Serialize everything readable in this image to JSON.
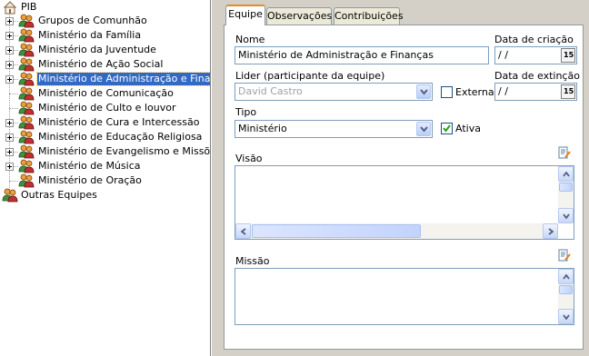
{
  "tree": {
    "root": "PIB",
    "items": [
      {
        "label": "Grupos de Comunhão",
        "expandable": true
      },
      {
        "label": "Ministério da Família",
        "expandable": true
      },
      {
        "label": "Ministério da Juventude",
        "expandable": true
      },
      {
        "label": "Ministério de Ação Social",
        "expandable": true
      },
      {
        "label": "Ministério de Administração e Finanças",
        "expandable": true,
        "selected": true
      },
      {
        "label": "Ministério de Comunicação",
        "expandable": false
      },
      {
        "label": "Ministério de Culto e louvor",
        "expandable": false
      },
      {
        "label": "Ministério de Cura e Intercessão",
        "expandable": true
      },
      {
        "label": "Ministério de Educação Religiosa",
        "expandable": true
      },
      {
        "label": "Ministério de Evangelismo e Missões",
        "expandable": true
      },
      {
        "label": "Ministério de Música",
        "expandable": true
      },
      {
        "label": "Ministério de Oração",
        "expandable": false
      }
    ],
    "other": "Outras Equipes"
  },
  "tabs": [
    "Equipe",
    "Observações",
    "Contribuições"
  ],
  "form": {
    "nome_label": "Nome",
    "nome_value": "Ministério de Administração e Finanças",
    "data_criacao_label": "Data de criação",
    "data_criacao_value": " / /",
    "lider_label": "Lider (participante da equipe)",
    "lider_value": "David Castro",
    "externa_label": "Externa",
    "externa_checked": false,
    "data_extincao_label": "Data de extinção",
    "data_extincao_value": " / /",
    "tipo_label": "Tipo",
    "tipo_value": "Ministério",
    "ativa_label": "Ativa",
    "ativa_checked": true,
    "visao_label": "Visão",
    "missao_label": "Missão",
    "calendar_glyph": "15"
  },
  "colors": {
    "selection": "#316ac5",
    "window_bg": "#d4d0c8",
    "tab_accent": "#e68b2c"
  }
}
